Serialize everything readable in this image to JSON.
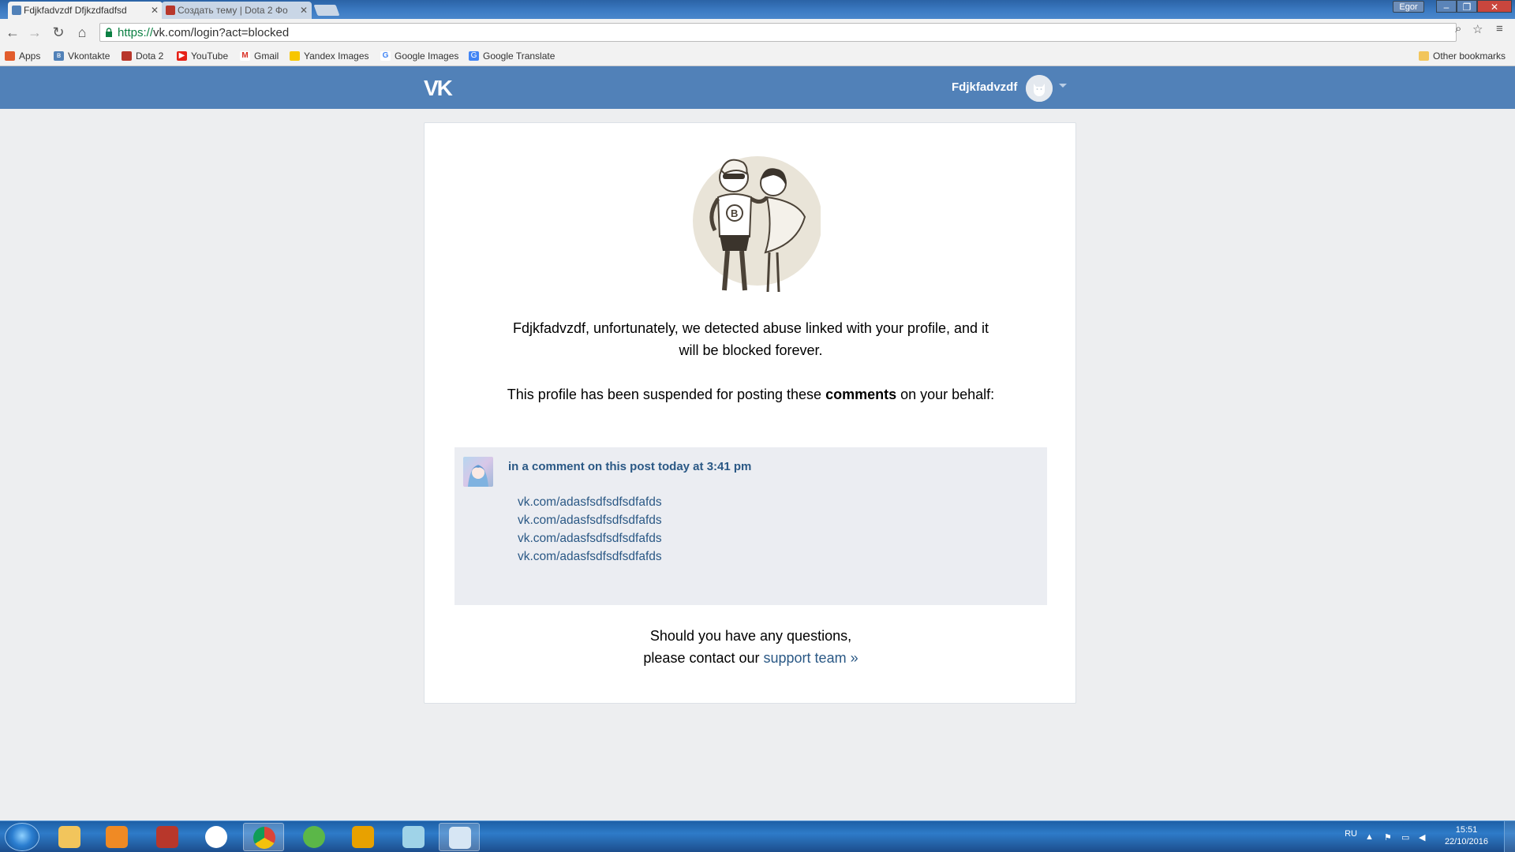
{
  "browser": {
    "tabs": [
      {
        "title": "Fdjkfadvzdf Dfjkzdfadfsd",
        "active": true
      },
      {
        "title": "Создать тему | Dota 2 Фо",
        "active": false
      }
    ],
    "profile_name": "Egor",
    "url_scheme": "https://",
    "url_rest": "vk.com/login?act=blocked",
    "bookmarks": [
      "Apps",
      "Vkontakte",
      "Dota 2",
      "YouTube",
      "Gmail",
      "Yandex Images",
      "Google Images",
      "Google Translate"
    ],
    "other_bookmarks": "Other bookmarks"
  },
  "vk": {
    "logo": "VK",
    "user_name": "Fdjkfadvzdf",
    "message_1": "Fdjkfadvzdf, unfortunately, we detected abuse linked with your profile, and it will be blocked forever.",
    "message_2_before": "This profile has been suspended for posting these ",
    "message_2_bold": "comments",
    "message_2_after": " on your behalf:",
    "comment": {
      "meta": "in a comment on this post today at 3:41 pm",
      "links": [
        "vk.com/adasfsdfsdfsdfafds",
        "vk.com/adasfsdfsdfsdfafds",
        "vk.com/adasfsdfsdfsdfafds",
        "vk.com/adasfsdfsdfsdfafds"
      ]
    },
    "footer_line_1": "Should you have any questions,",
    "footer_line_2": "please contact our ",
    "support_link": "support team »"
  },
  "taskbar": {
    "language": "RU",
    "time": "15:51",
    "date": "22/10/2016"
  },
  "colors": {
    "vk_header": "#5181b8",
    "link": "#2a5885",
    "page_bg": "#edeef0"
  }
}
